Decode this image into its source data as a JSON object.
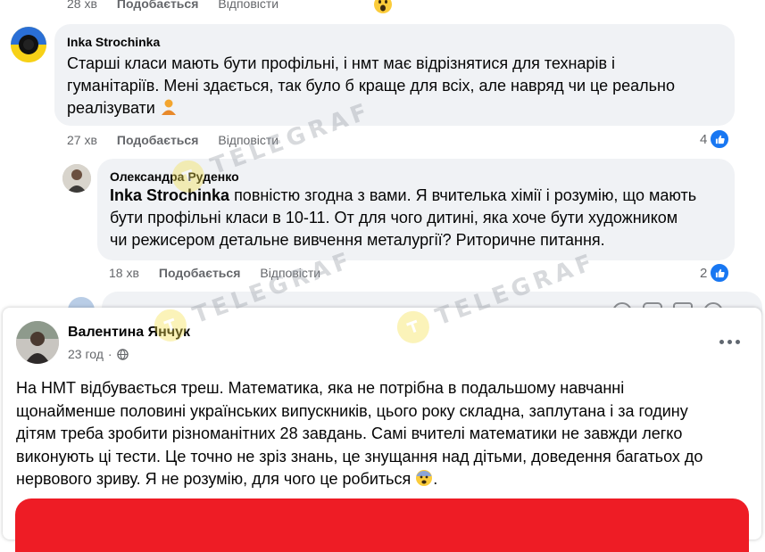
{
  "top_meta": {
    "time": "28 хв",
    "like": "Подобається",
    "reply": "Відповісти"
  },
  "comment1": {
    "author": "Inka Strochinka",
    "lines": [
      "Старші класи мають бути профільні, і нмт має відрізнятися для технарів і",
      "гуманітаріїв. Мені здається, так було б краще для всіх, але навряд чи це реально",
      "реалізувати"
    ],
    "time": "27 хв",
    "like": "Подобається",
    "reply": "Відповісти",
    "likes": "4"
  },
  "comment2": {
    "author": "Олександра Руденко",
    "mention": "Inka Strochinka",
    "lines": [
      "повністю згодна з вами. Я вчителька хімії і розумію, що мають",
      "бути профільні класи в 10-11. От для чого дитині, яка хоче бути художником",
      "чи режисером детальне вивчення металургії? Риторичне питання."
    ],
    "time": "18 хв",
    "like": "Подобається",
    "reply": "Відповісти",
    "likes": "2"
  },
  "post": {
    "author": "Валентина Янчук",
    "time": "23 год",
    "separator": "·",
    "lines": [
      "На НМТ відбувається треш. Математика, яка не потрібна в подальшому навчанні",
      "щонайменше половині українських випускників, цього року складна, заплутана і за годину",
      "дітям треба зробити різноманітних  28 завдань. Самі вчителі математики не завжди легко",
      "виконують ці тести.  Це точно не зріз знань, це знущання над дітьми, доведення багатьох до",
      "нервового зриву. Я не розумію, для чого це робиться"
    ],
    "end_punct": "."
  },
  "watermark": {
    "text": "TELEGRAF"
  },
  "colors": {
    "like_blue": "#1877f2",
    "bubble_bg": "#f0f2f5",
    "meta_gray": "#65676b",
    "red_banner": "#ee1c25"
  },
  "icons": {
    "like": "thumbs-up-icon",
    "globe": "globe-icon",
    "more": "more-dots-icon"
  }
}
